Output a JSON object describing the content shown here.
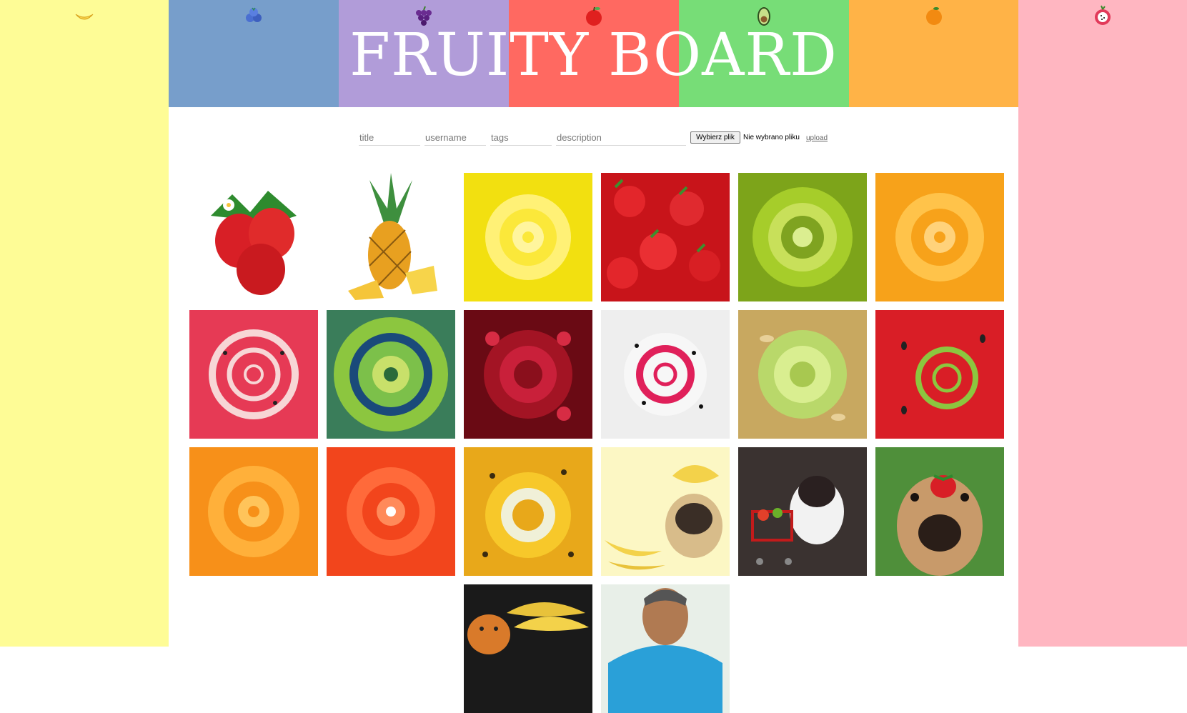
{
  "strips": [
    {
      "color": "#fefc96",
      "icon": "banana-icon"
    },
    {
      "color": "#779ecb",
      "icon": "blueberry-icon"
    },
    {
      "color": "#b19cd9",
      "icon": "grapes-icon"
    },
    {
      "color": "#ff6961",
      "icon": "apple-icon"
    },
    {
      "color": "#77dd77",
      "icon": "avocado-icon"
    },
    {
      "color": "#ffb347",
      "icon": "orange-icon"
    },
    {
      "color": "#ffb6c1",
      "icon": "dragonfruit-icon"
    }
  ],
  "header": {
    "title": "FRUITY BOARD"
  },
  "form": {
    "title_placeholder": "title",
    "username_placeholder": "username",
    "tags_placeholder": "tags",
    "description_placeholder": "description",
    "file_button_label": "Wybierz plik",
    "file_status": "Nie wybrano pliku",
    "upload_label": "upload"
  },
  "gallery": [
    {
      "subject": "strawberries"
    },
    {
      "subject": "pineapple"
    },
    {
      "subject": "lemon-spiral"
    },
    {
      "subject": "strawberry-spiral"
    },
    {
      "subject": "kiwi-spiral"
    },
    {
      "subject": "orange-spiral"
    },
    {
      "subject": "watermelon-spiral"
    },
    {
      "subject": "kiwi-spiral-2"
    },
    {
      "subject": "pomegranate-spiral"
    },
    {
      "subject": "dragonfruit-spiral"
    },
    {
      "subject": "melon-spiral"
    },
    {
      "subject": "watermelon-spiral-2"
    },
    {
      "subject": "orange-spiral-2"
    },
    {
      "subject": "grapefruit-spiral"
    },
    {
      "subject": "passionfruit-spiral"
    },
    {
      "subject": "pug-banana"
    },
    {
      "subject": "puppy-cart"
    },
    {
      "subject": "dog-strawberry"
    },
    {
      "subject": "cat-bananas"
    },
    {
      "subject": "man-portrait"
    }
  ]
}
